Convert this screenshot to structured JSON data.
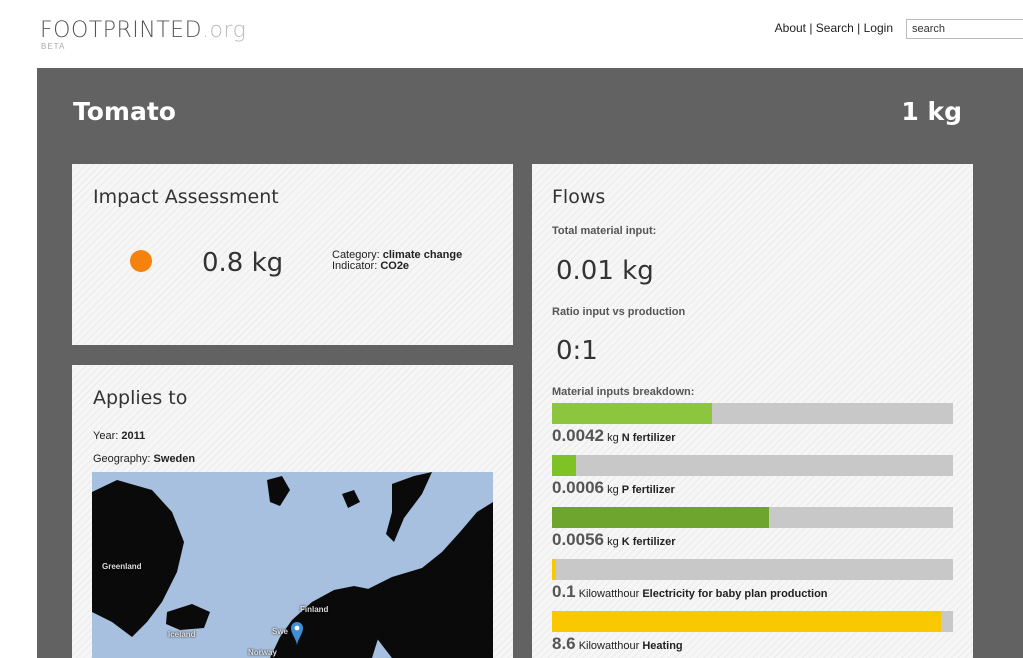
{
  "header": {
    "logo_main": "FOOTPRINTED",
    "logo_suffix": ".org",
    "beta": "BETA",
    "nav": {
      "about": "About",
      "sep1": " | ",
      "search": "Search",
      "sep2": " | ",
      "login": "Login"
    },
    "search_value": "search"
  },
  "product": {
    "name": "Tomato",
    "quantity": "1 kg"
  },
  "impact": {
    "title": "Impact Assessment",
    "dot_color": "#f5820d",
    "value": "0.8 kg",
    "category_label": "Category: ",
    "category_value": "climate change",
    "indicator_label": "Indicator: ",
    "indicator_value": "CO2e"
  },
  "applies": {
    "title": "Applies to",
    "year_label": "Year: ",
    "year_value": "2011",
    "geo_label": "Geography: ",
    "geo_value": "Sweden",
    "map_labels": {
      "greenland": "Greenland",
      "iceland": "Iceland",
      "finland": "Finland",
      "norway": "Norway",
      "sweden": "Swe"
    }
  },
  "flows": {
    "title": "Flows",
    "total_label": "Total material input:",
    "total_value": "0.01 kg",
    "ratio_label": "Ratio input vs production",
    "ratio_value": "0:1",
    "breakdown_label": "Material inputs breakdown:",
    "items": [
      {
        "value": "0.0042",
        "unit": "kg",
        "name": "N fertilizer",
        "fraction": 0.4,
        "color": "#8cc63e"
      },
      {
        "value": "0.0006",
        "unit": "kg",
        "name": "P fertilizer",
        "fraction": 0.06,
        "color": "#7fc226"
      },
      {
        "value": "0.0056",
        "unit": "kg",
        "name": "K fertilizer",
        "fraction": 0.54,
        "color": "#6ea52e"
      },
      {
        "value": "0.1",
        "unit": "Kilowatthour",
        "name": "Electricity for baby plan production",
        "fraction": 0.01,
        "color": "#f9c800"
      },
      {
        "value": "8.6",
        "unit": "Kilowatthour",
        "name": "Heating",
        "fraction": 0.97,
        "color": "#f9c800"
      }
    ]
  }
}
